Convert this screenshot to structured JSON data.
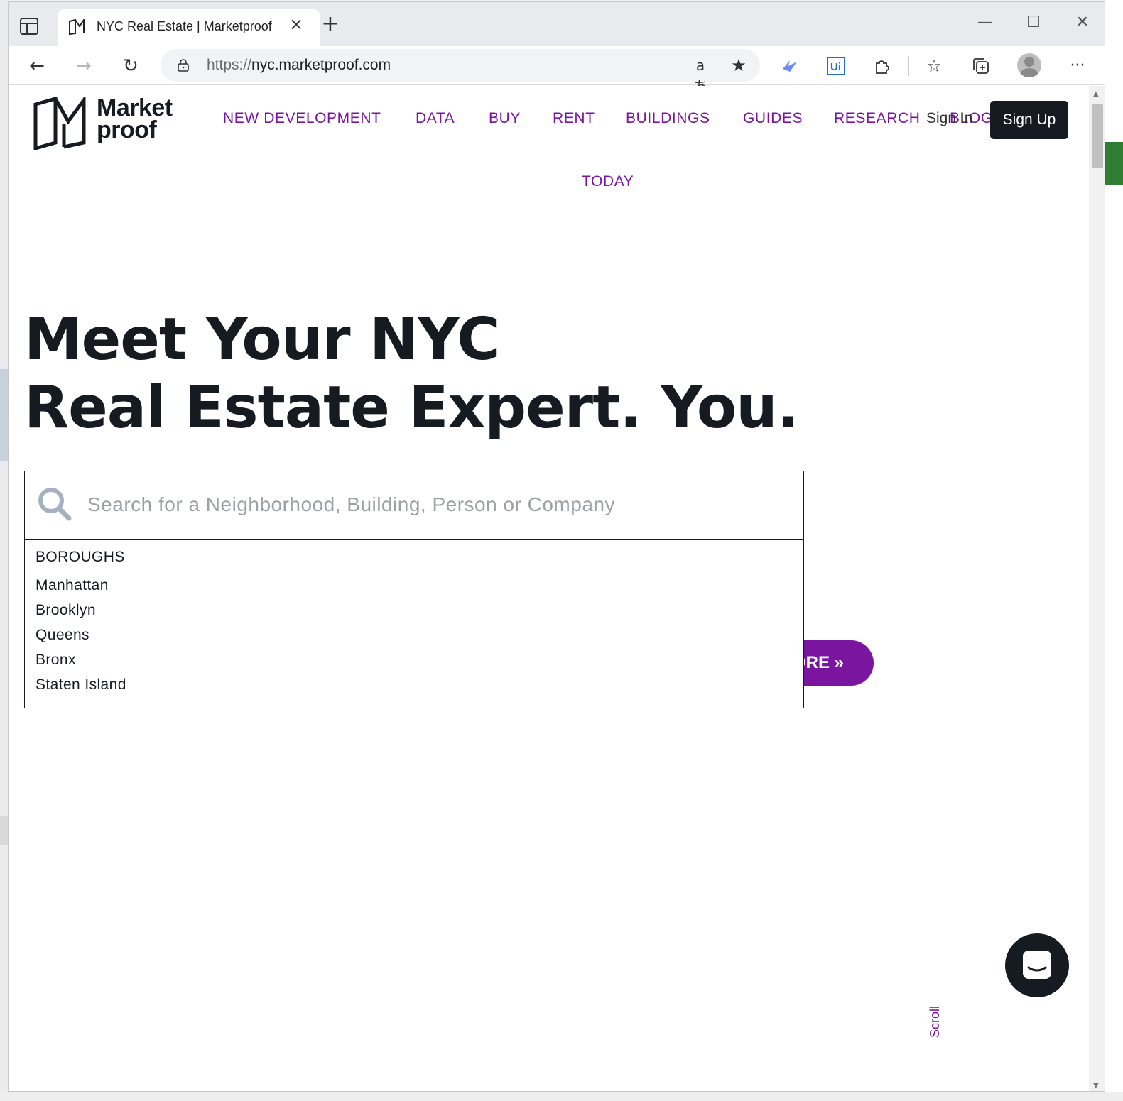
{
  "browser": {
    "tab_title": "NYC Real Estate | Marketproof",
    "url_scheme": "https://",
    "url_host": "nyc.marketproof.com",
    "translate_glyph": "aあ"
  },
  "site": {
    "logo_line1": "Market",
    "logo_line2": "proof",
    "nav": [
      {
        "label": "NEW DEVELOPMENT"
      },
      {
        "label": "DATA"
      },
      {
        "label": "BUY"
      },
      {
        "label": "RENT"
      },
      {
        "label": "BUILDINGS"
      },
      {
        "label": "GUIDES"
      },
      {
        "label": "RESEARCH"
      },
      {
        "label": "BLOG"
      },
      {
        "label": "TODAY"
      }
    ],
    "sign_in": "Sign In",
    "sign_up": "Sign Up"
  },
  "hero": {
    "headline_line1": "Meet Your NYC",
    "headline_line2": "Real Estate Expert. You.",
    "explore_button": "ORE »"
  },
  "search": {
    "placeholder": "Search for a Neighborhood, Building, Person or Company",
    "value": "",
    "dropdown_heading": "BOROUGHS",
    "boroughs": [
      "Manhattan",
      "Brooklyn",
      "Queens",
      "Bronx",
      "Staten Island"
    ]
  },
  "misc": {
    "scroll_label": "Scroll"
  },
  "colors": {
    "brand_purple": "#7a15a0",
    "dark": "#161b22"
  }
}
